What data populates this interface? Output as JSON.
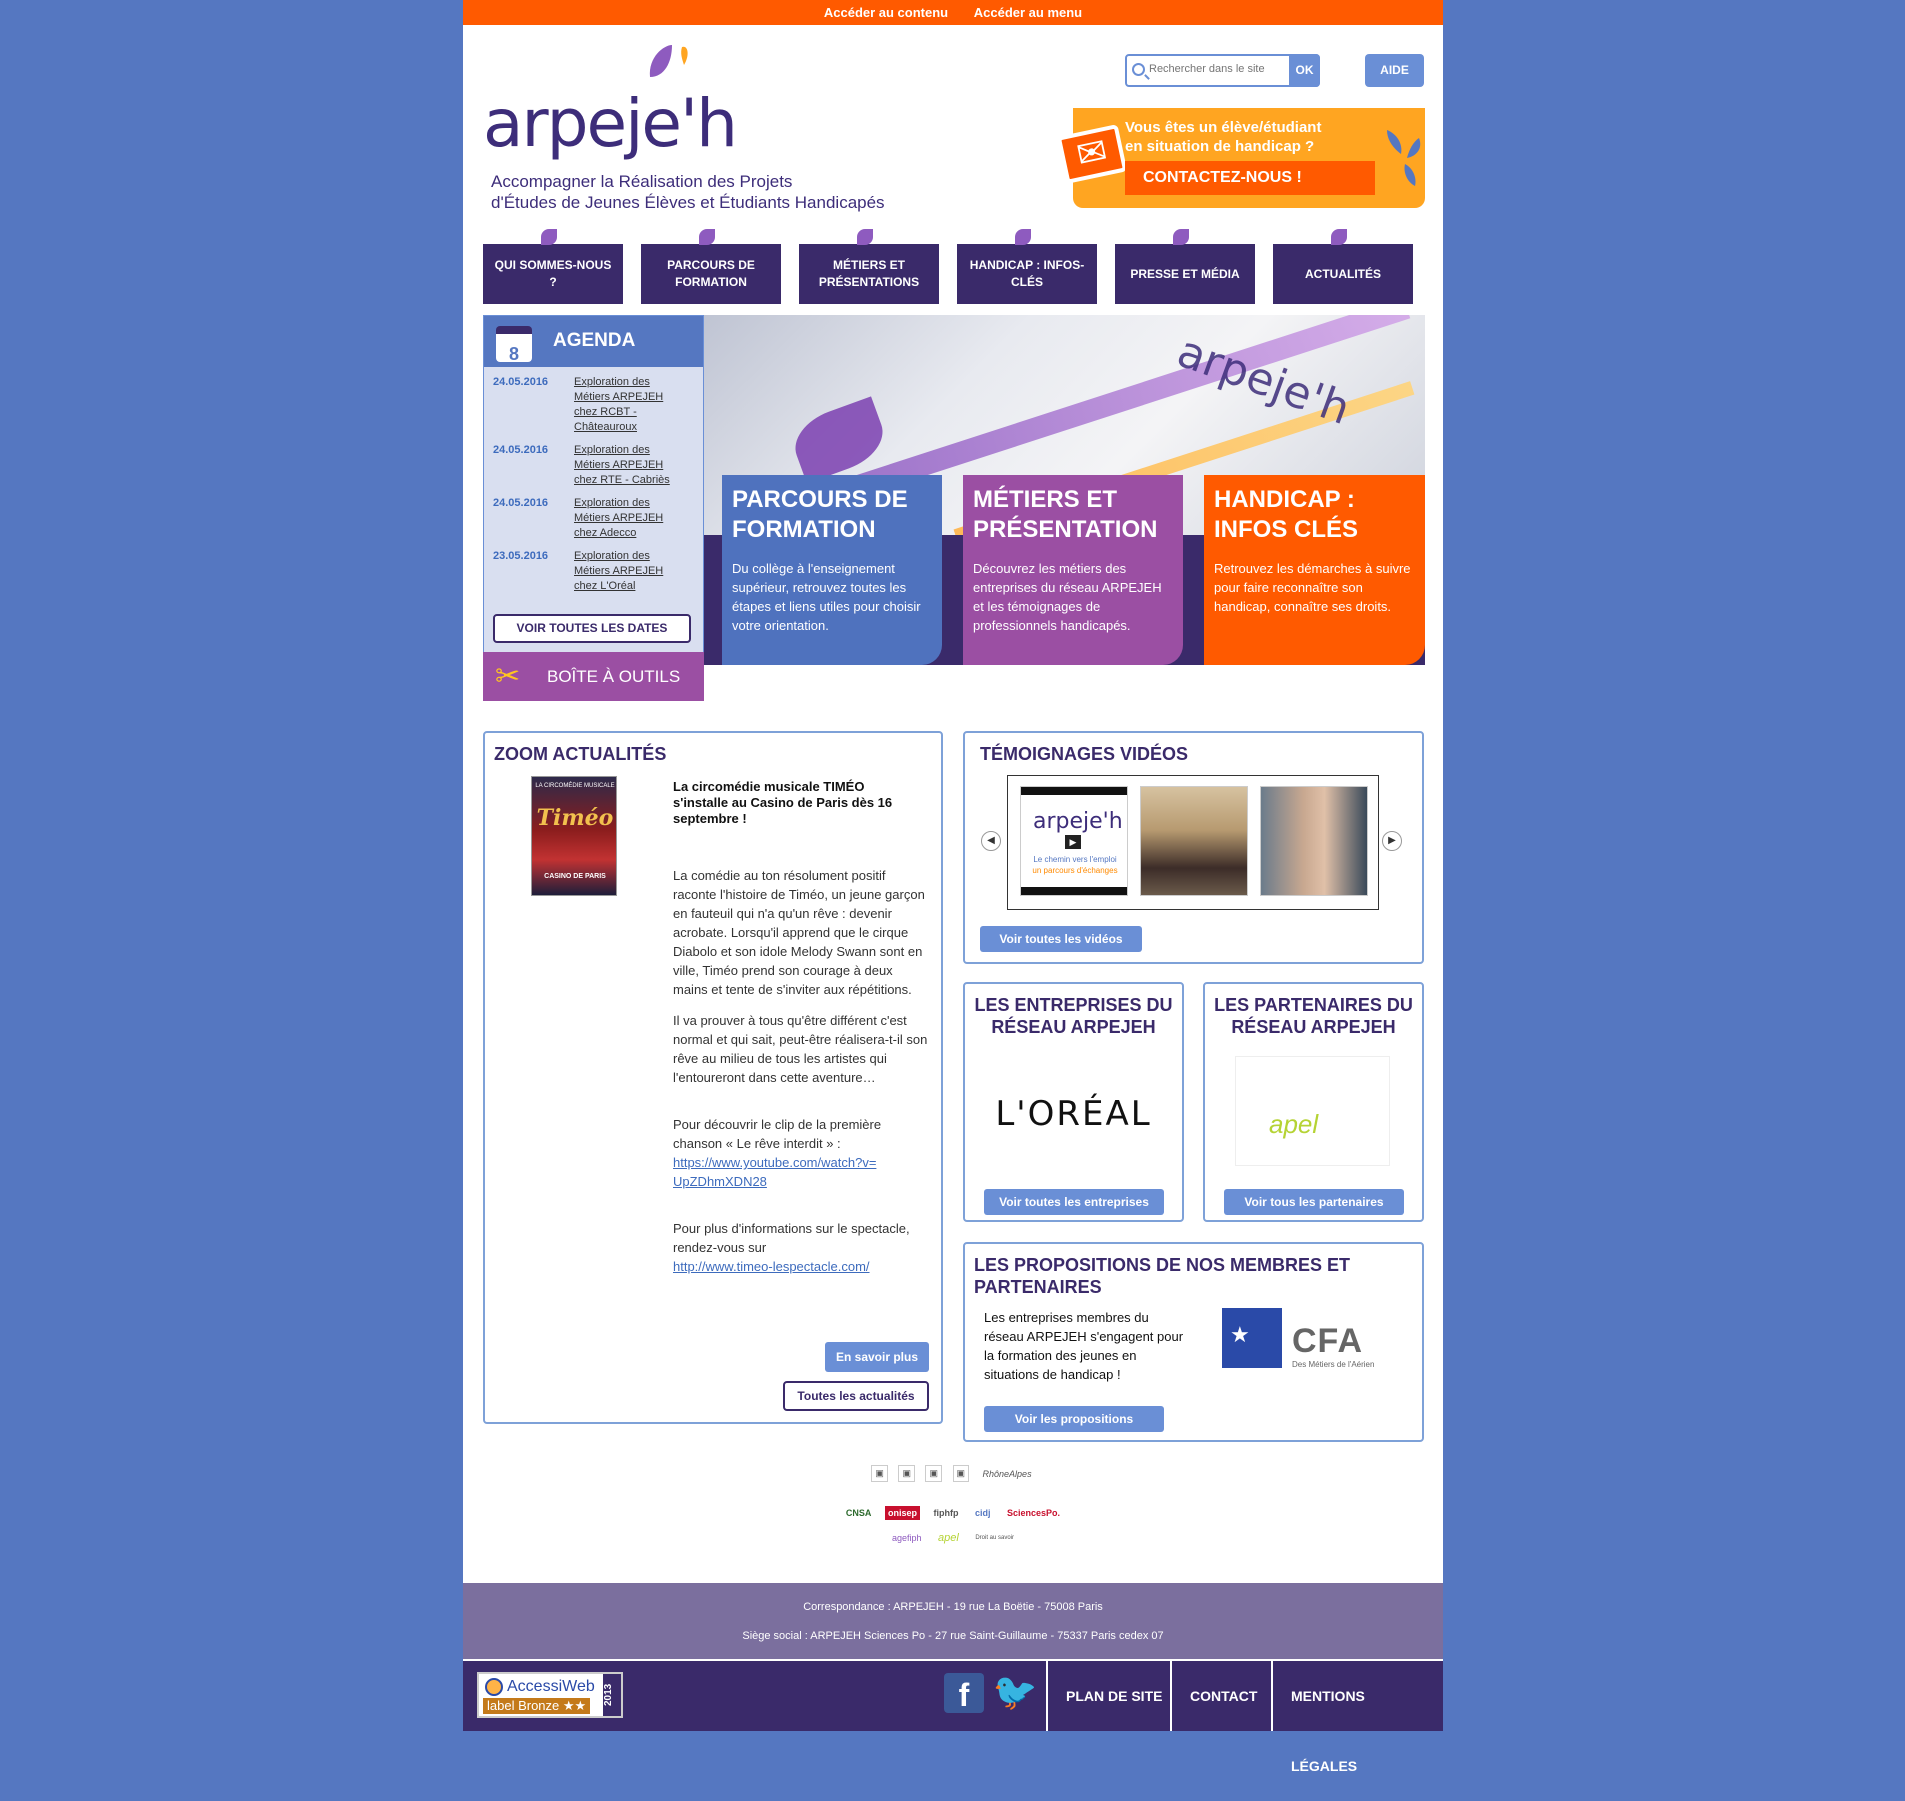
{
  "skip": {
    "content": "Accéder au contenu",
    "menu": "Accéder au menu"
  },
  "logo": {
    "word": "arpeje'h",
    "tagline_1": "Accompagner la Réalisation des Projets",
    "tagline_2": "d'Études de Jeunes Élèves et Étudiants Handicapés"
  },
  "search": {
    "placeholder": "Rechercher dans le site",
    "ok": "OK"
  },
  "aide": "AIDE",
  "contact_banner": {
    "question_1": "Vous êtes un élève/étudiant",
    "question_2": "en situation de handicap ?",
    "button": "CONTACTEZ-NOUS !"
  },
  "nav": [
    {
      "label": "QUI SOMMES-NOUS ?"
    },
    {
      "label": "PARCOURS DE FORMATION"
    },
    {
      "label": "MÉTIERS ET PRÉSENTATIONS"
    },
    {
      "label": "HANDICAP : INFOS-CLÉS"
    },
    {
      "label": "PRESSE ET MÉDIA"
    },
    {
      "label": "ACTUALITÉS"
    }
  ],
  "agenda": {
    "calendar_day": "8",
    "title": "AGENDA",
    "items": [
      {
        "date": "24.05.2016",
        "text": "Exploration des Métiers ARPEJEH chez RCBT - Châteauroux"
      },
      {
        "date": "24.05.2016",
        "text": "Exploration des Métiers ARPEJEH chez RTE - Cabriès"
      },
      {
        "date": "24.05.2016",
        "text": "Exploration des Métiers ARPEJEH chez Adecco"
      },
      {
        "date": "23.05.2016",
        "text": "Exploration des Métiers ARPEJEH chez L'Oréal"
      }
    ],
    "all_dates": "VOIR TOUTES LES DATES"
  },
  "boite": "BOÎTE À OUTILS",
  "hero": {
    "photo_word": "arpeje'h",
    "cards": [
      {
        "title": "PARCOURS DE FORMATION",
        "text": "Du collège à l'enseignement supérieur, retrouvez toutes les étapes et liens utiles pour choisir votre orientation.",
        "color": "#4f72be"
      },
      {
        "title": "MÉTIERS ET PRÉSENTATION",
        "text": "Découvrez les métiers des entreprises du réseau ARPEJEH et les témoignages de professionnels handicapés.",
        "color": "#9b4fa3"
      },
      {
        "title": "HANDICAP : INFOS CLÉS",
        "text": "Retrouvez les démarches à suivre pour faire reconnaître son handicap, connaître ses droits.",
        "color": "#ff5a00"
      }
    ]
  },
  "zoom": {
    "title": "ZOOM ACTUALITÉS",
    "poster": {
      "top": "LA CIRCOMÉDIE MUSICALE",
      "name": "Timéo",
      "venue": "CASINO DE PARIS"
    },
    "headline": "La circomédie musicale TIMÉO s'installe au Casino de Paris dès 16 septembre !",
    "p1": "La comédie au ton résolument positif raconte l'histoire de Timéo, un jeune garçon en fauteuil qui n'a qu'un rêve : devenir acrobate. Lorsqu'il apprend que le cirque Diabolo et son idole Melody Swann sont en ville, Timéo prend son courage à deux mains et tente de s'inviter aux répétitions.",
    "p2": "Il va prouver à tous qu'être différent c'est normal et qui sait, peut-être réalisera-t-il son rêve au milieu de tous les artistes qui l'entoureront dans cette aventure…",
    "p3": "Pour découvrir le clip de la première chanson « Le rêve interdit » :",
    "link1": "https://www.youtube.com/watch?v=UpZDhmXDN28",
    "p4": "Pour plus d'informations sur le spectacle, rendez-vous sur",
    "link2": "http://www.timeo-lespectacle.com/",
    "more": "En savoir plus",
    "all": "Toutes les actualités"
  },
  "videos": {
    "title": "TÉMOIGNAGES VIDÉOS",
    "thumb1_word": "arpeje'h",
    "thumb1_line1": "Le chemin vers l'emploi",
    "thumb1_line2": "un parcours d'échanges",
    "all": "Voir toutes les vidéos"
  },
  "entreprises": {
    "title": "LES ENTREPRISES DU RÉSEAU ARPEJEH",
    "logo": "L'ORÉAL",
    "all": "Voir toutes les entreprises"
  },
  "partenaires": {
    "title": "LES PARTENAIRES DU RÉSEAU ARPEJEH",
    "logo": "apel",
    "all": "Voir tous les partenaires"
  },
  "propositions": {
    "title": "LES PROPOSITIONS DE NOS MEMBRES ET PARTENAIRES",
    "text": "Les entreprises membres du réseau ARPEJEH s'engagent pour la formation des jeunes en situations de handicap !",
    "logo_word": "CFA",
    "logo_sub": "Des Métiers de l'Aérien",
    "all": "Voir les propositions"
  },
  "partner_logos": {
    "row1": [
      "▣",
      "▣",
      "▣",
      "▣",
      "RhôneAlpes"
    ],
    "row2": [
      "CNSA",
      "onisep",
      "fiphfp",
      "cidj",
      "SciencesPo."
    ],
    "row3": [
      "agefiph",
      "apel",
      "Droit au savoir"
    ]
  },
  "footer": {
    "addr1": "Correspondance : ARPEJEH - 19 rue La Boëtie - 75008 Paris",
    "addr2": "Siège social : ARPEJEH Sciences Po - 27 rue Saint-Guillaume - 75337 Paris cedex 07",
    "accessi": "AccessiWeb",
    "label": "label Bronze ★★",
    "year": "2013",
    "fb": "f",
    "tw": "🐦",
    "links": [
      "PLAN DE SITE",
      "CONTACT",
      "MENTIONS LÉGALES"
    ]
  }
}
